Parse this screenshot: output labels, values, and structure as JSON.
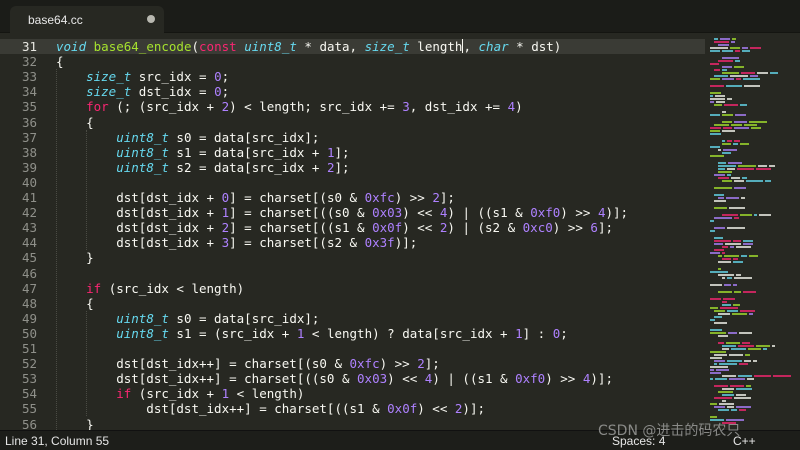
{
  "tab": {
    "title": "base64.cc"
  },
  "editor": {
    "active_line": "31",
    "lines": [
      {
        "n": "31",
        "tokens": [
          {
            "t": "void",
            "c": "ty"
          },
          {
            "t": " "
          },
          {
            "t": "base64_encode",
            "c": "f"
          },
          {
            "t": "("
          },
          {
            "t": "const",
            "c": "k"
          },
          {
            "t": " "
          },
          {
            "t": "uint8_t",
            "c": "ty"
          },
          {
            "t": " * data, "
          },
          {
            "t": "size_t",
            "c": "ty"
          },
          {
            "t": " length"
          },
          {
            "cursor": true
          },
          {
            "t": ", "
          },
          {
            "t": "char",
            "c": "ty"
          },
          {
            "t": " * dst)"
          }
        ]
      },
      {
        "n": "32",
        "tokens": [
          {
            "t": "{"
          }
        ]
      },
      {
        "n": "33",
        "tokens": [
          {
            "t": "    "
          },
          {
            "t": "size_t",
            "c": "ty"
          },
          {
            "t": " src_idx = "
          },
          {
            "t": "0",
            "c": "n"
          },
          {
            "t": ";"
          }
        ]
      },
      {
        "n": "34",
        "tokens": [
          {
            "t": "    "
          },
          {
            "t": "size_t",
            "c": "ty"
          },
          {
            "t": " dst_idx = "
          },
          {
            "t": "0",
            "c": "n"
          },
          {
            "t": ";"
          }
        ]
      },
      {
        "n": "35",
        "tokens": [
          {
            "t": "    "
          },
          {
            "t": "for",
            "c": "k"
          },
          {
            "t": " (; (src_idx + "
          },
          {
            "t": "2",
            "c": "n"
          },
          {
            "t": ") < length; src_idx += "
          },
          {
            "t": "3",
            "c": "n"
          },
          {
            "t": ", dst_idx += "
          },
          {
            "t": "4",
            "c": "n"
          },
          {
            "t": ")"
          }
        ]
      },
      {
        "n": "36",
        "tokens": [
          {
            "t": "    {"
          }
        ]
      },
      {
        "n": "37",
        "tokens": [
          {
            "t": "        "
          },
          {
            "t": "uint8_t",
            "c": "ty"
          },
          {
            "t": " s0 = data[src_idx];"
          }
        ]
      },
      {
        "n": "38",
        "tokens": [
          {
            "t": "        "
          },
          {
            "t": "uint8_t",
            "c": "ty"
          },
          {
            "t": " s1 = data[src_idx + "
          },
          {
            "t": "1",
            "c": "n"
          },
          {
            "t": "];"
          }
        ]
      },
      {
        "n": "39",
        "tokens": [
          {
            "t": "        "
          },
          {
            "t": "uint8_t",
            "c": "ty"
          },
          {
            "t": " s2 = data[src_idx + "
          },
          {
            "t": "2",
            "c": "n"
          },
          {
            "t": "];"
          }
        ]
      },
      {
        "n": "40",
        "tokens": []
      },
      {
        "n": "41",
        "tokens": [
          {
            "t": "        dst[dst_idx + "
          },
          {
            "t": "0",
            "c": "n"
          },
          {
            "t": "] = charset[(s0 & "
          },
          {
            "t": "0xfc",
            "c": "n"
          },
          {
            "t": ") >> "
          },
          {
            "t": "2",
            "c": "n"
          },
          {
            "t": "];"
          }
        ]
      },
      {
        "n": "42",
        "tokens": [
          {
            "t": "        dst[dst_idx + "
          },
          {
            "t": "1",
            "c": "n"
          },
          {
            "t": "] = charset[((s0 & "
          },
          {
            "t": "0x03",
            "c": "n"
          },
          {
            "t": ") << "
          },
          {
            "t": "4",
            "c": "n"
          },
          {
            "t": ") | ((s1 & "
          },
          {
            "t": "0xf0",
            "c": "n"
          },
          {
            "t": ") >> "
          },
          {
            "t": "4",
            "c": "n"
          },
          {
            "t": ")];"
          }
        ]
      },
      {
        "n": "43",
        "tokens": [
          {
            "t": "        dst[dst_idx + "
          },
          {
            "t": "2",
            "c": "n"
          },
          {
            "t": "] = charset[((s1 & "
          },
          {
            "t": "0x0f",
            "c": "n"
          },
          {
            "t": ") << "
          },
          {
            "t": "2",
            "c": "n"
          },
          {
            "t": ") | (s2 & "
          },
          {
            "t": "0xc0",
            "c": "n"
          },
          {
            "t": ") >> "
          },
          {
            "t": "6",
            "c": "n"
          },
          {
            "t": "];"
          }
        ]
      },
      {
        "n": "44",
        "tokens": [
          {
            "t": "        dst[dst_idx + "
          },
          {
            "t": "3",
            "c": "n"
          },
          {
            "t": "] = charset[(s2 & "
          },
          {
            "t": "0x3f",
            "c": "n"
          },
          {
            "t": ")];"
          }
        ]
      },
      {
        "n": "45",
        "tokens": [
          {
            "t": "    }"
          }
        ]
      },
      {
        "n": "46",
        "tokens": []
      },
      {
        "n": "47",
        "tokens": [
          {
            "t": "    "
          },
          {
            "t": "if",
            "c": "k"
          },
          {
            "t": " (src_idx < length)"
          }
        ]
      },
      {
        "n": "48",
        "tokens": [
          {
            "t": "    {"
          }
        ]
      },
      {
        "n": "49",
        "tokens": [
          {
            "t": "        "
          },
          {
            "t": "uint8_t",
            "c": "ty"
          },
          {
            "t": " s0 = data[src_idx];"
          }
        ]
      },
      {
        "n": "50",
        "tokens": [
          {
            "t": "        "
          },
          {
            "t": "uint8_t",
            "c": "ty"
          },
          {
            "t": " s1 = (src_idx + "
          },
          {
            "t": "1",
            "c": "n"
          },
          {
            "t": " < length) ? data[src_idx + "
          },
          {
            "t": "1",
            "c": "n"
          },
          {
            "t": "] : "
          },
          {
            "t": "0",
            "c": "n"
          },
          {
            "t": ";"
          }
        ]
      },
      {
        "n": "51",
        "tokens": []
      },
      {
        "n": "52",
        "tokens": [
          {
            "t": "        dst[dst_idx++] = charset[(s0 & "
          },
          {
            "t": "0xfc",
            "c": "n"
          },
          {
            "t": ") >> "
          },
          {
            "t": "2",
            "c": "n"
          },
          {
            "t": "];"
          }
        ]
      },
      {
        "n": "53",
        "tokens": [
          {
            "t": "        dst[dst_idx++] = charset[((s0 & "
          },
          {
            "t": "0x03",
            "c": "n"
          },
          {
            "t": ") << "
          },
          {
            "t": "4",
            "c": "n"
          },
          {
            "t": ") | ((s1 & "
          },
          {
            "t": "0xf0",
            "c": "n"
          },
          {
            "t": ") >> "
          },
          {
            "t": "4",
            "c": "n"
          },
          {
            "t": ")];"
          }
        ]
      },
      {
        "n": "54",
        "tokens": [
          {
            "t": "        "
          },
          {
            "t": "if",
            "c": "k"
          },
          {
            "t": " (src_idx + "
          },
          {
            "t": "1",
            "c": "n"
          },
          {
            "t": " < length)"
          }
        ]
      },
      {
        "n": "55",
        "tokens": [
          {
            "t": "            dst[dst_idx++] = charset[((s1 & "
          },
          {
            "t": "0x0f",
            "c": "n"
          },
          {
            "t": ") << "
          },
          {
            "t": "2",
            "c": "n"
          },
          {
            "t": ")];"
          }
        ]
      },
      {
        "n": "56",
        "tokens": [
          {
            "t": "    }"
          }
        ]
      }
    ]
  },
  "status": {
    "position": "Line 31, Column 55",
    "spaces": "Spaces: 4",
    "syntax": "C++"
  },
  "watermark": "CSDN @进击的码农只",
  "colors": {
    "background": "#272822",
    "keyword": "#f92672",
    "type": "#66d9ef",
    "number": "#ae81ff",
    "function": "#a6e22e",
    "text": "#f8f8f2"
  }
}
